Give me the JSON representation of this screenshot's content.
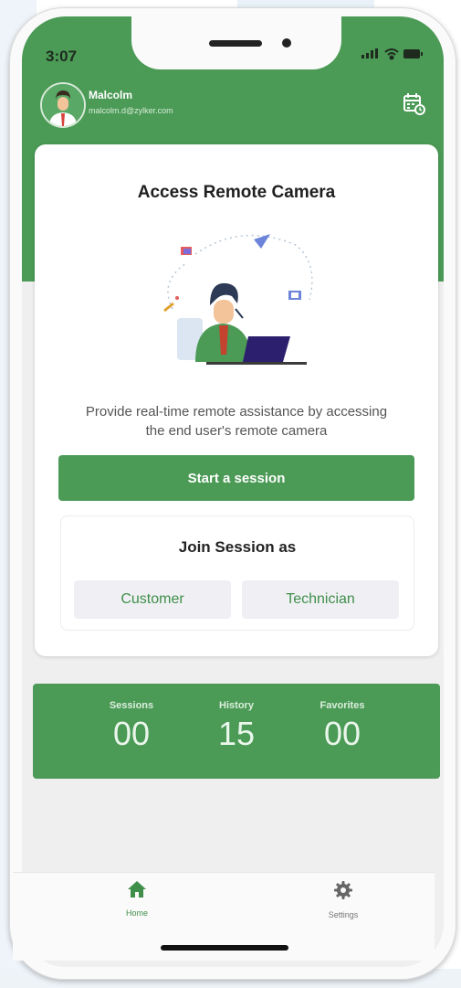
{
  "status_bar": {
    "time": "3:07"
  },
  "user": {
    "name": "Malcolm",
    "email": "malcolm.d@zylker.com"
  },
  "card": {
    "title": "Access Remote Camera",
    "description_line1": "Provide real-time remote assistance by accessing",
    "description_line2": "the end user's remote camera",
    "start_button": "Start a session",
    "join": {
      "title": "Join Session as",
      "customer": "Customer",
      "technician": "Technician"
    }
  },
  "stats": [
    {
      "label": "Sessions",
      "value": "00"
    },
    {
      "label": "History",
      "value": "15"
    },
    {
      "label": "Favorites",
      "value": "00"
    }
  ],
  "tabs": [
    {
      "label": "Home",
      "icon": "home-icon",
      "active": true
    },
    {
      "label": "Settings",
      "icon": "gear-icon",
      "active": false
    }
  ],
  "colors": {
    "brand_green": "#4b9a56",
    "background": "#efefef"
  }
}
